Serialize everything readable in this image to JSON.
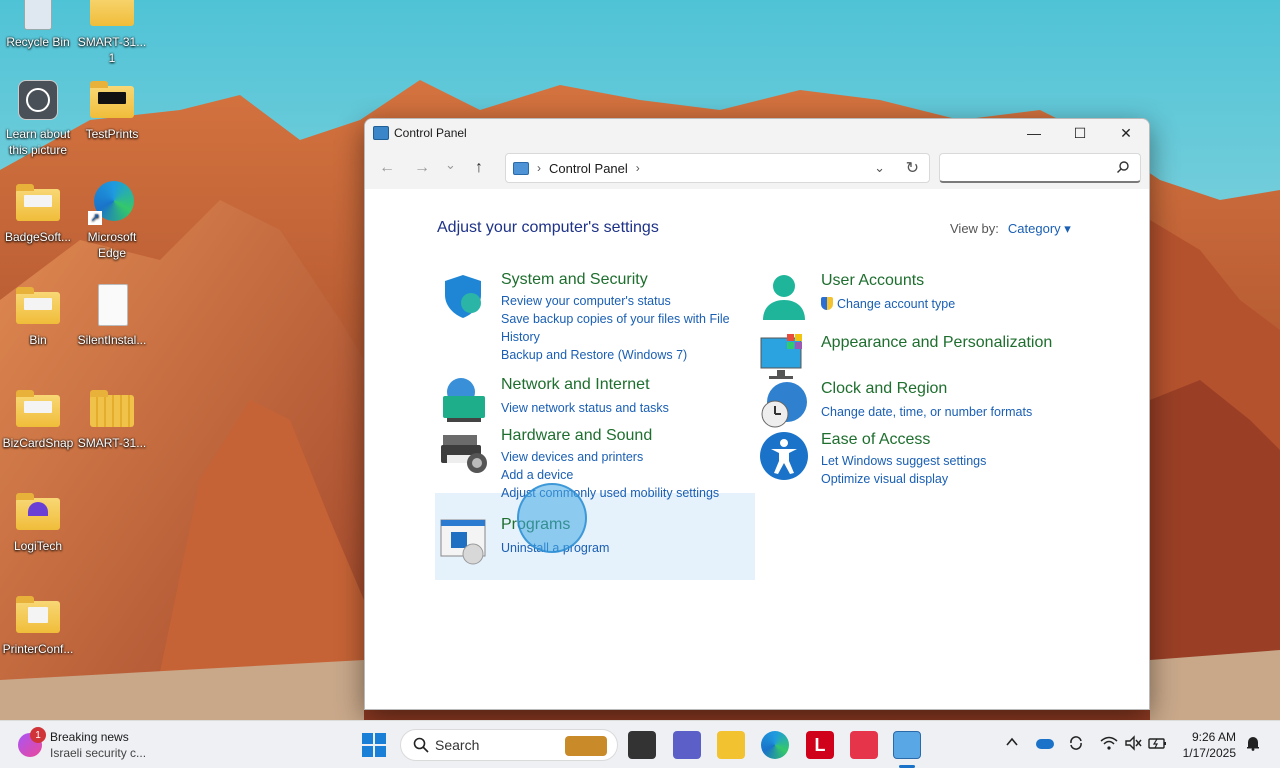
{
  "desktop": {
    "icons": [
      {
        "label": "Recycle Bin"
      },
      {
        "label": "SMART-31...\n1"
      },
      {
        "label": "Learn about\nthis picture"
      },
      {
        "label": "TestPrints"
      },
      {
        "label": "BadgeSoft..."
      },
      {
        "label": "Microsoft\nEdge"
      },
      {
        "label": "Bin"
      },
      {
        "label": "SilentInstal..."
      },
      {
        "label": "BizCardSnap"
      },
      {
        "label": "SMART-31..."
      },
      {
        "label": "LogiTech"
      },
      {
        "label": "PrinterConf..."
      }
    ]
  },
  "window": {
    "title": "Control Panel",
    "controls": {
      "minimize": "—",
      "maximize": "☐",
      "close": "✕"
    },
    "nav": {
      "back": "←",
      "forward": "→",
      "recent": "⌄",
      "up": "↑"
    },
    "address": {
      "crumb": "Control Panel",
      "sep1": "›",
      "sep2": "›",
      "dropdown": "⌄",
      "refresh": "↻"
    },
    "search": {
      "value": "",
      "placeholder": ""
    },
    "heading": "Adjust your computer's settings",
    "view_by": {
      "label": "View by:",
      "value": "Category ▾"
    },
    "categories": {
      "system": {
        "title": "System and Security",
        "links": [
          "Review your computer's status",
          "Save backup copies of your files with File",
          "History",
          "Backup and Restore (Windows 7)"
        ]
      },
      "network": {
        "title": "Network and Internet",
        "links": [
          "View network status and tasks"
        ]
      },
      "hardware": {
        "title": "Hardware and Sound",
        "links": [
          "View devices and printers",
          "Add a device",
          "Adjust commonly used mobility settings"
        ]
      },
      "programs": {
        "title": "Programs",
        "links": [
          "Uninstall a program"
        ]
      },
      "users": {
        "title": "User Accounts",
        "links": [
          "Change account type"
        ]
      },
      "appearance": {
        "title": "Appearance and Personalization",
        "links": []
      },
      "clock": {
        "title": "Clock and Region",
        "links": [
          "Change date, time, or number formats"
        ]
      },
      "ease": {
        "title": "Ease of Access",
        "links": [
          "Let Windows suggest settings",
          "Optimize visual display"
        ]
      }
    }
  },
  "taskbar": {
    "news": {
      "badge": "1",
      "title": "Breaking news",
      "subtitle": "Israeli security c..."
    },
    "search_label": "Search",
    "time": "9:26 AM",
    "date": "1/17/2025",
    "lettermark": "L"
  }
}
